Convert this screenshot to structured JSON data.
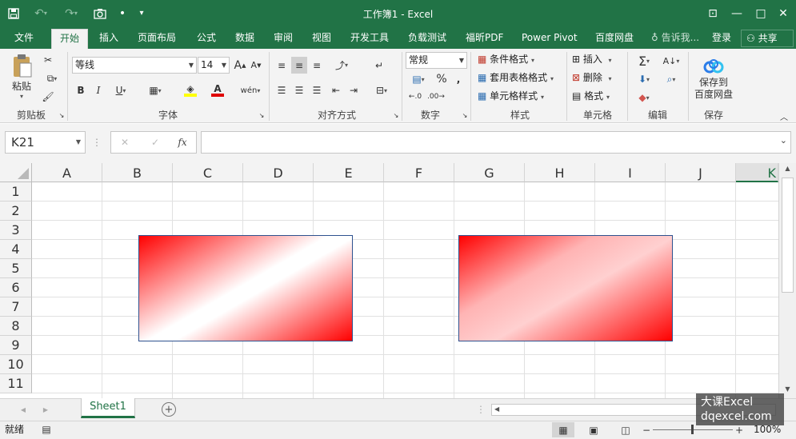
{
  "window": {
    "title": "工作簿1 - Excel"
  },
  "qat": {
    "save_icon": "save-icon",
    "undo_icon": "undo-icon",
    "redo_icon": "redo-icon",
    "camera_icon": "camera-icon",
    "bullet": "•",
    "customize": "▾"
  },
  "window_controls": {
    "ribbon_display": "⊡",
    "minimize": "—",
    "maximize": "□",
    "close": "✕"
  },
  "tabs": [
    "文件",
    "开始",
    "插入",
    "页面布局",
    "公式",
    "数据",
    "审阅",
    "视图",
    "开发工具",
    "负载测试",
    "福昕PDF",
    "Power Pivot",
    "百度网盘"
  ],
  "active_tab": "开始",
  "tell_me": "告诉我...",
  "sign_in": "登录",
  "share": "共享",
  "ribbon": {
    "clipboard": {
      "paste": "粘贴",
      "label": "剪贴板"
    },
    "font": {
      "name": "等线",
      "size": "14",
      "bold": "B",
      "italic": "I",
      "underline": "U",
      "grow": "A",
      "shrink": "A",
      "wen": "wén",
      "label": "字体"
    },
    "alignment": {
      "label": "对齐方式"
    },
    "number": {
      "format": "常规",
      "percent": "%",
      "comma": ",",
      "label": "数字"
    },
    "styles": {
      "conditional": "条件格式",
      "table": "套用表格格式",
      "cell_styles": "单元格样式",
      "label": "样式"
    },
    "cells": {
      "insert": "插入",
      "delete": "删除",
      "format": "格式",
      "label": "单元格"
    },
    "editing": {
      "label": "编辑"
    },
    "save": {
      "button": "保存到\n百度网盘",
      "line1": "保存到",
      "line2": "百度网盘",
      "label": "保存"
    }
  },
  "formula_bar": {
    "name_box": "K21",
    "cancel": "✕",
    "enter": "✓",
    "fx": "fx",
    "value": ""
  },
  "columns": [
    "A",
    "B",
    "C",
    "D",
    "E",
    "F",
    "G",
    "H",
    "I",
    "J",
    "K"
  ],
  "rows": [
    "1",
    "2",
    "3",
    "4",
    "5",
    "6",
    "7",
    "8",
    "9",
    "10",
    "11"
  ],
  "sheets": [
    "Sheet1"
  ],
  "status": {
    "ready": "就绪",
    "zoom": "100%"
  },
  "watermark": {
    "line1": "大课Excel",
    "line2": "dqexcel.com"
  },
  "colors": {
    "accent": "#217346",
    "gradient_red": "#ff0000",
    "shape_border": "#2f528f"
  }
}
